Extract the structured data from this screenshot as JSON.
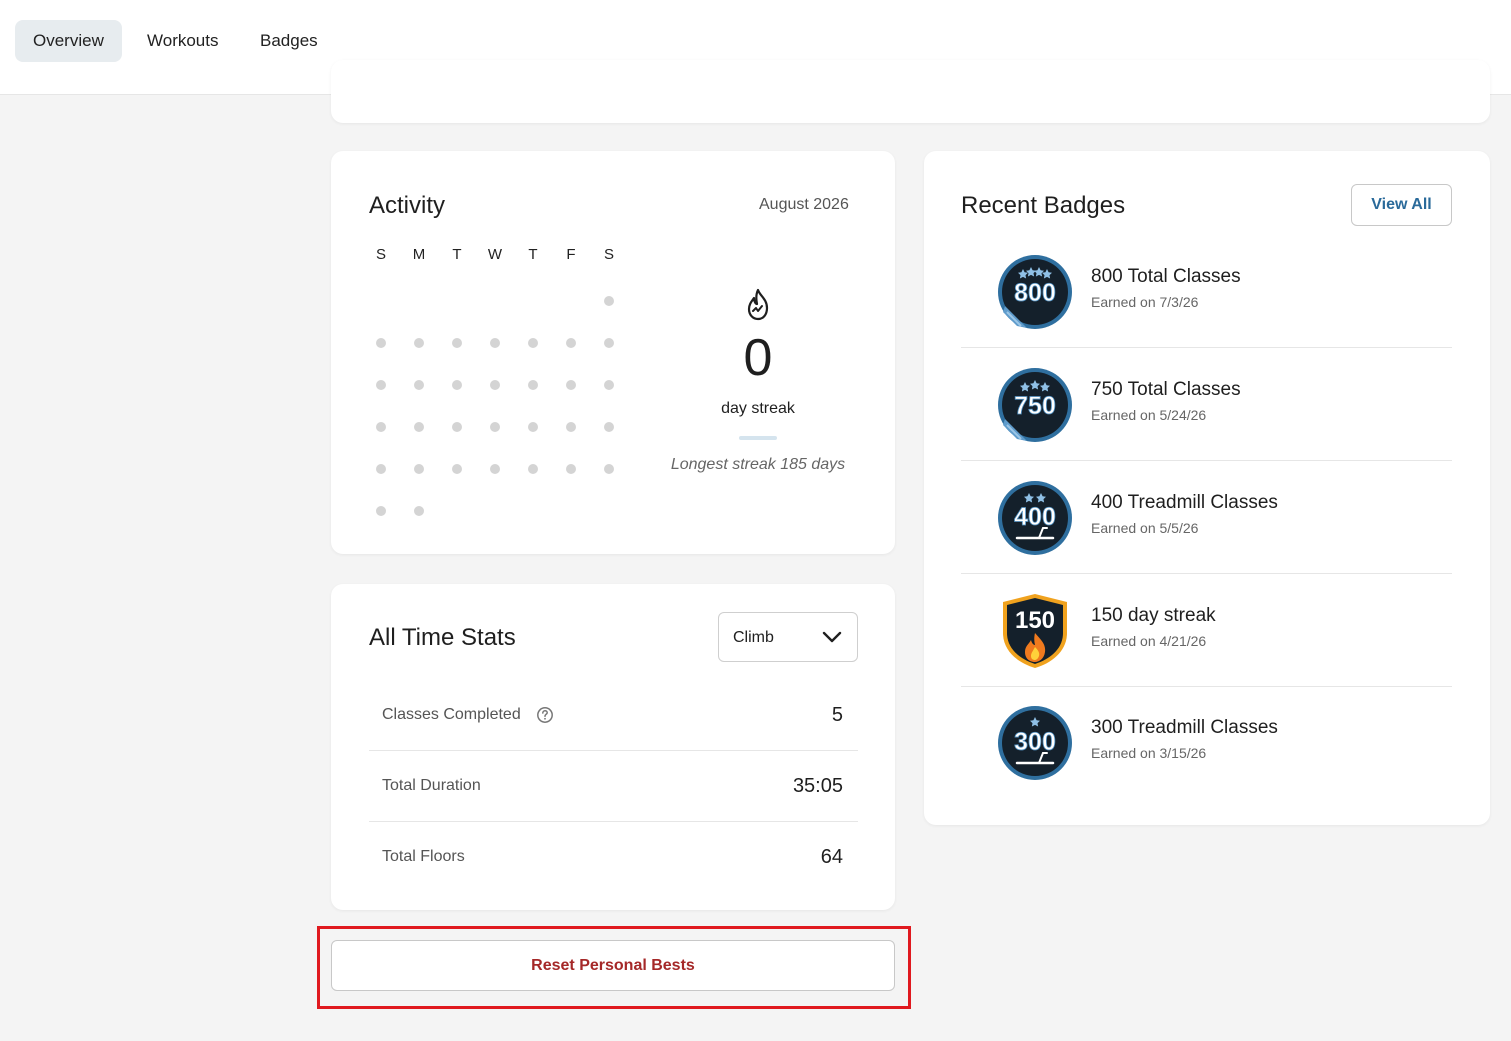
{
  "tabs": [
    {
      "label": "Overview",
      "active": true
    },
    {
      "label": "Workouts",
      "active": false
    },
    {
      "label": "Badges",
      "active": false
    }
  ],
  "activity": {
    "title": "Activity",
    "month": "August 2026",
    "weekdays": [
      "S",
      "M",
      "T",
      "W",
      "T",
      "F",
      "S"
    ],
    "first_weekday_index": 6,
    "days_in_month": 31,
    "active_days": [],
    "streak_value": "0",
    "streak_label": "day streak",
    "longest_streak": "Longest streak 185 days"
  },
  "stats": {
    "title": "All Time Stats",
    "filter_selected": "Climb",
    "rows": [
      {
        "label": "Classes Completed",
        "value": "5",
        "has_help": true
      },
      {
        "label": "Total Duration",
        "value": "35:05",
        "has_help": false
      },
      {
        "label": "Total Floors",
        "value": "64",
        "has_help": false
      }
    ]
  },
  "reset_button": "Reset Personal Bests",
  "badges": {
    "title": "Recent Badges",
    "view_all": "View All",
    "items": [
      {
        "number": "800",
        "name": "800 Total Classes",
        "earned": "Earned on 7/3/26",
        "icon": "total-classes-badge-icon"
      },
      {
        "number": "750",
        "name": "750 Total Classes",
        "earned": "Earned on 5/24/26",
        "icon": "total-classes-badge-icon"
      },
      {
        "number": "400",
        "name": "400 Treadmill Classes",
        "earned": "Earned on 5/5/26",
        "icon": "treadmill-badge-icon"
      },
      {
        "number": "150",
        "name": "150 day streak",
        "earned": "Earned on 4/21/26",
        "icon": "streak-badge-icon"
      },
      {
        "number": "300",
        "name": "300 Treadmill Classes",
        "earned": "Earned on 3/15/26",
        "icon": "treadmill-badge-icon"
      }
    ]
  },
  "colors": {
    "accent": "#2a6a9a",
    "danger": "#a52828",
    "highlight": "#e0191f",
    "badge_dark": "#14202b",
    "badge_blue": "#3f7fb0",
    "streak_orange": "#f07a1e"
  }
}
